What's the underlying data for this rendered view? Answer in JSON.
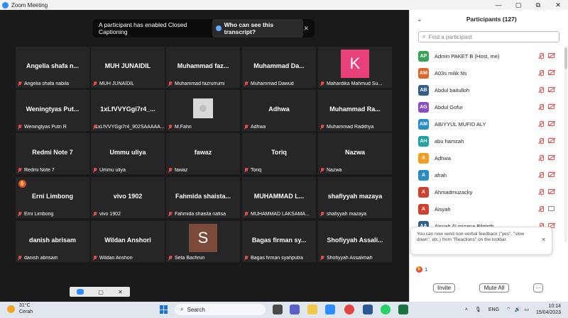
{
  "window": {
    "title": "Zoom Meeting",
    "controls": [
      "—",
      "▢",
      "⧉",
      "✕"
    ]
  },
  "cc_banner": {
    "text": "A participant has enabled Closed Captioning",
    "who_label": "Who can see this transcript?",
    "close": "✕"
  },
  "tiles": [
    {
      "big": "Angelia shafa n...",
      "small": "Angelia shafa nabila"
    },
    {
      "big": "MUH JUNAIDIL",
      "small": "MUH JUNAIDIL"
    },
    {
      "big": "Muhammad faz...",
      "small": "Muhammad fazrurrumi"
    },
    {
      "big": "Muhammad Da...",
      "small": "Muhammad Dawud"
    },
    {
      "big": "",
      "small": "Mahardika Mahmud Su...",
      "avatar_letter": "K",
      "avatar_color": "#e8407a"
    },
    {
      "big": "Weningtyas Put...",
      "small": "Weningtyas Putri R"
    },
    {
      "big": "1xLfVVYGgi7r4_...",
      "small": "1xLfVVYGgi7r4_902SAAAAA..."
    },
    {
      "big": "",
      "small": "M.Fahri",
      "avatar_photo": true
    },
    {
      "big": "Adhwa",
      "small": "Adhwa"
    },
    {
      "big": "Muhammad Ra...",
      "small": "Muhammad Radithya"
    },
    {
      "big": "Redmi Note 7",
      "small": "Redmi Note 7"
    },
    {
      "big": "Ummu uliya",
      "small": "Ummu uliya"
    },
    {
      "big": "fawaz",
      "small": "fawaz"
    },
    {
      "big": "Toriq",
      "small": "Toriq"
    },
    {
      "big": "Nazwa",
      "small": "Nazwa"
    },
    {
      "big": "Erni Limbong",
      "small": "Erni Limbong",
      "raised_hand": true
    },
    {
      "big": "vivo 1902",
      "small": "vivo 1902"
    },
    {
      "big": "Fahmida shaista...",
      "small": "Fahmida shaista nafisa"
    },
    {
      "big": "MUHAMMAD L...",
      "small": "MUHAMMAD LAKSAMA..."
    },
    {
      "big": "shafiyyah mazaya",
      "small": "shafiyyah mazaya"
    },
    {
      "big": "danish abrisam",
      "small": "danish abrisam"
    },
    {
      "big": "Wildan Anshori",
      "small": "Wildan Anshori"
    },
    {
      "big": "",
      "small": "Seta Bachrun",
      "avatar_letter": "S",
      "avatar_color": "#7a4a3a"
    },
    {
      "big": "Bagas firman sy...",
      "small": "Bagas firman syahputra"
    },
    {
      "big": "Shofiyyah Assali...",
      "small": "Shofiyyah Assalimah"
    }
  ],
  "panel": {
    "title": "Participants (127)",
    "search_placeholder": "Find a participant",
    "participants": [
      {
        "initials": "AP",
        "name": "Admin PAKET B (Host, me)",
        "color": "#3aa655",
        "cam_on": false
      },
      {
        "initials": "AM",
        "name": "A03s milik Ns",
        "color": "#e0652a",
        "cam_on": false
      },
      {
        "initials": "AB",
        "name": "Abdul baitulloh",
        "color": "#2f5f8a",
        "cam_on": false
      },
      {
        "initials": "AG",
        "name": "Abdul Gofur",
        "color": "#8a4fc8",
        "cam_on": false
      },
      {
        "initials": "AM",
        "name": "ABIYYUL MUFID ALY",
        "color": "#2a8cc7",
        "cam_on": false
      },
      {
        "initials": "AH",
        "name": "abu hamzah",
        "color": "#22a3a3",
        "cam_on": false
      },
      {
        "initials": "A",
        "name": "Adhwa",
        "color": "#f0a020",
        "cam_on": false
      },
      {
        "initials": "A",
        "name": "afrah",
        "color": "#2a8cc7",
        "cam_on": false
      },
      {
        "initials": "A",
        "name": "Ahmadmuzacky",
        "color": "#d0402f",
        "cam_on": false
      },
      {
        "initials": "A",
        "name": "Aisyah",
        "color": "#d0402f",
        "cam_on": true
      },
      {
        "initials": "AA",
        "name": "Aisyah Al mizana Bilqisth",
        "color": "#2f5f8a",
        "cam_on": false
      }
    ],
    "tip_text": "You can now send non-verbal feedback (\"yes\", \"slow down\", etc.) from \"Reactions\" on the toolbar.",
    "tip_close": "✕",
    "raised_count": "1",
    "invite_label": "Invite",
    "mute_all_label": "Mute All",
    "more_label": "···"
  },
  "taskbar": {
    "temp": "31°C",
    "weather": "Cerah",
    "search_label": "Search",
    "lang": "ENG",
    "time": "10:14",
    "date": "15/04/2023"
  }
}
